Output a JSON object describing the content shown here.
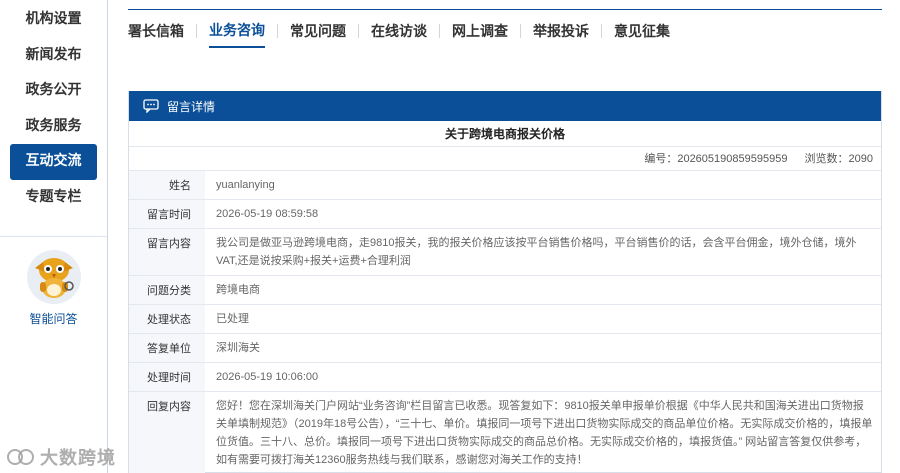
{
  "sidebar": {
    "items": [
      {
        "label": "机构设置"
      },
      {
        "label": "新闻发布"
      },
      {
        "label": "政务公开"
      },
      {
        "label": "政务服务"
      },
      {
        "label": "互动交流",
        "active": true
      },
      {
        "label": "专题专栏"
      }
    ],
    "assistant_label": "智能问答"
  },
  "tabs": [
    {
      "label": "署长信箱"
    },
    {
      "label": "业务咨询",
      "active": true
    },
    {
      "label": "常见问题"
    },
    {
      "label": "在线访谈"
    },
    {
      "label": "网上调查"
    },
    {
      "label": "举报投诉"
    },
    {
      "label": "意见征集"
    }
  ],
  "panel": {
    "header_title": "留言详情",
    "message_title": "关于跨境电商报关价格",
    "meta": {
      "number_text": "编号：202605190859595959",
      "views_text": "浏览数：2090"
    },
    "rows": [
      {
        "label": "姓名",
        "value": "yuanlanying"
      },
      {
        "label": "留言时间",
        "value": "2026-05-19 08:59:58"
      },
      {
        "label": "留言内容",
        "value": "我公司是做亚马逊跨境电商，走9810报关，我的报关价格应该按平台销售价格吗，平台销售价的话，会含平台佣金，境外仓储，境外VAT,还是说按采购+报关+运费+合理利润"
      },
      {
        "label": "问题分类",
        "value": "跨境电商"
      },
      {
        "label": "处理状态",
        "value": "已处理"
      },
      {
        "label": "答复单位",
        "value": "深圳海关"
      },
      {
        "label": "处理时间",
        "value": "2026-05-19 10:06:00"
      },
      {
        "label": "回复内容",
        "value": "您好！您在深圳海关门户网站“业务咨询”栏目留言已收悉。现答复如下：9810报关单申报单价根据《中华人民共和国海关进出口货物报关单填制规范》（2019年18号公告），“三十七、单价。填报同一项号下进出口货物实际成交的商品单位价格。无实际成交价格的，填报单位货值。三十八、总价。填报同一项号下进出口货物实际成交的商品总价格。无实际成交价格的，填报货值。” 网站留言答复仅供参考，如有需要可拨打海关12360服务热线与我们联系，感谢您对海关工作的支持！"
      }
    ]
  },
  "watermark": {
    "text": "大数跨境"
  },
  "colors": {
    "brand_blue": "#0a4f97",
    "label_bg": "#f5f7fa",
    "border": "#e3e8ef"
  }
}
